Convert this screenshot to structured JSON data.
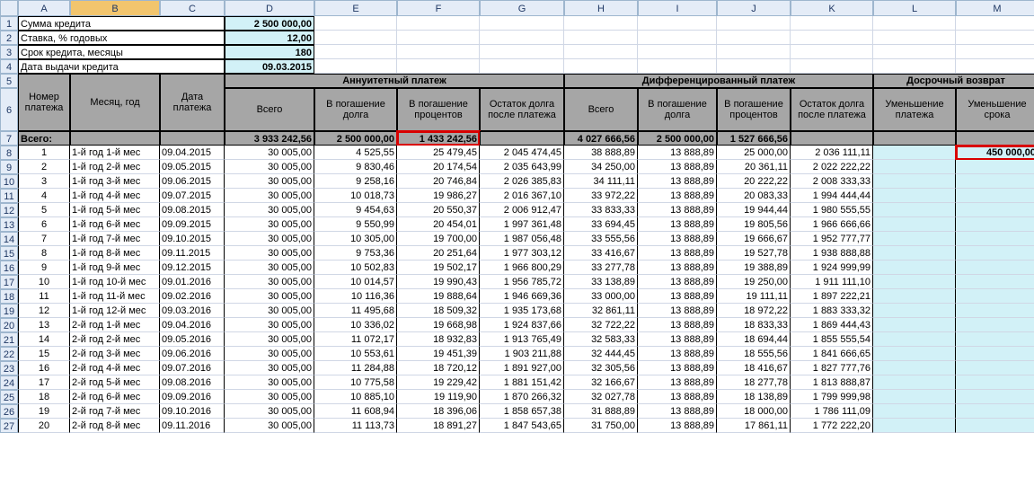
{
  "cols": [
    "",
    "A",
    "B",
    "C",
    "D",
    "E",
    "F",
    "G",
    "H",
    "I",
    "J",
    "K",
    "L",
    "M"
  ],
  "params": {
    "p1": {
      "label": "Сумма кредита",
      "value": "2 500 000,00"
    },
    "p2": {
      "label": "Ставка, % годовых",
      "value": "12,00"
    },
    "p3": {
      "label": "Срок кредита, месяцы",
      "value": "180"
    },
    "p4": {
      "label": "Дата выдачи кредита",
      "value": "09.03.2015"
    }
  },
  "headers": {
    "num": "Номер платежа",
    "month": "Месяц, год",
    "date": "Дата платежа",
    "ann": "Аннуитетный платеж",
    "diff": "Дифференцированный платеж",
    "early": "Досрочный возврат",
    "total": "Всего",
    "toDebt": "В погашение долга",
    "toPct": "В погашение процентов",
    "remain": "Остаток долга после платежа",
    "decPay": "Уменьшение платежа",
    "decTerm": "Уменьшение срока",
    "allRow": "Всего:"
  },
  "totals": {
    "annTotal": "3 933 242,56",
    "annDebt": "2 500 000,00",
    "annPct": "1 433 242,56",
    "diffTotal": "4 027 666,56",
    "diffDebt": "2 500 000,00",
    "diffPct": "1 527 666,56",
    "early": "450 000,00"
  },
  "rows": [
    {
      "n": "1",
      "m": "1-й год 1-й мес",
      "d": "09.04.2015",
      "a1": "30 005,00",
      "a2": "4 525,55",
      "a3": "25 479,45",
      "a4": "2 045 474,45",
      "b1": "38 888,89",
      "b2": "13 888,89",
      "b3": "25 000,00",
      "b4": "2 036 111,11"
    },
    {
      "n": "2",
      "m": "1-й год 2-й мес",
      "d": "09.05.2015",
      "a1": "30 005,00",
      "a2": "9 830,46",
      "a3": "20 174,54",
      "a4": "2 035 643,99",
      "b1": "34 250,00",
      "b2": "13 888,89",
      "b3": "20 361,11",
      "b4": "2 022 222,22"
    },
    {
      "n": "3",
      "m": "1-й год 3-й мес",
      "d": "09.06.2015",
      "a1": "30 005,00",
      "a2": "9 258,16",
      "a3": "20 746,84",
      "a4": "2 026 385,83",
      "b1": "34 111,11",
      "b2": "13 888,89",
      "b3": "20 222,22",
      "b4": "2 008 333,33"
    },
    {
      "n": "4",
      "m": "1-й год 4-й мес",
      "d": "09.07.2015",
      "a1": "30 005,00",
      "a2": "10 018,73",
      "a3": "19 986,27",
      "a4": "2 016 367,10",
      "b1": "33 972,22",
      "b2": "13 888,89",
      "b3": "20 083,33",
      "b4": "1 994 444,44"
    },
    {
      "n": "5",
      "m": "1-й год 5-й мес",
      "d": "09.08.2015",
      "a1": "30 005,00",
      "a2": "9 454,63",
      "a3": "20 550,37",
      "a4": "2 006 912,47",
      "b1": "33 833,33",
      "b2": "13 888,89",
      "b3": "19 944,44",
      "b4": "1 980 555,55"
    },
    {
      "n": "6",
      "m": "1-й год 6-й мес",
      "d": "09.09.2015",
      "a1": "30 005,00",
      "a2": "9 550,99",
      "a3": "20 454,01",
      "a4": "1 997 361,48",
      "b1": "33 694,45",
      "b2": "13 888,89",
      "b3": "19 805,56",
      "b4": "1 966 666,66"
    },
    {
      "n": "7",
      "m": "1-й год 7-й мес",
      "d": "09.10.2015",
      "a1": "30 005,00",
      "a2": "10 305,00",
      "a3": "19 700,00",
      "a4": "1 987 056,48",
      "b1": "33 555,56",
      "b2": "13 888,89",
      "b3": "19 666,67",
      "b4": "1 952 777,77"
    },
    {
      "n": "8",
      "m": "1-й год 8-й мес",
      "d": "09.11.2015",
      "a1": "30 005,00",
      "a2": "9 753,36",
      "a3": "20 251,64",
      "a4": "1 977 303,12",
      "b1": "33 416,67",
      "b2": "13 888,89",
      "b3": "19 527,78",
      "b4": "1 938 888,88"
    },
    {
      "n": "9",
      "m": "1-й год 9-й мес",
      "d": "09.12.2015",
      "a1": "30 005,00",
      "a2": "10 502,83",
      "a3": "19 502,17",
      "a4": "1 966 800,29",
      "b1": "33 277,78",
      "b2": "13 888,89",
      "b3": "19 388,89",
      "b4": "1 924 999,99"
    },
    {
      "n": "10",
      "m": "1-й год 10-й мес",
      "d": "09.01.2016",
      "a1": "30 005,00",
      "a2": "10 014,57",
      "a3": "19 990,43",
      "a4": "1 956 785,72",
      "b1": "33 138,89",
      "b2": "13 888,89",
      "b3": "19 250,00",
      "b4": "1 911 111,10"
    },
    {
      "n": "11",
      "m": "1-й год 11-й мес",
      "d": "09.02.2016",
      "a1": "30 005,00",
      "a2": "10 116,36",
      "a3": "19 888,64",
      "a4": "1 946 669,36",
      "b1": "33 000,00",
      "b2": "13 888,89",
      "b3": "19 111,11",
      "b4": "1 897 222,21"
    },
    {
      "n": "12",
      "m": "1-й год 12-й мес",
      "d": "09.03.2016",
      "a1": "30 005,00",
      "a2": "11 495,68",
      "a3": "18 509,32",
      "a4": "1 935 173,68",
      "b1": "32 861,11",
      "b2": "13 888,89",
      "b3": "18 972,22",
      "b4": "1 883 333,32"
    },
    {
      "n": "13",
      "m": "2-й год 1-й мес",
      "d": "09.04.2016",
      "a1": "30 005,00",
      "a2": "10 336,02",
      "a3": "19 668,98",
      "a4": "1 924 837,66",
      "b1": "32 722,22",
      "b2": "13 888,89",
      "b3": "18 833,33",
      "b4": "1 869 444,43"
    },
    {
      "n": "14",
      "m": "2-й год 2-й мес",
      "d": "09.05.2016",
      "a1": "30 005,00",
      "a2": "11 072,17",
      "a3": "18 932,83",
      "a4": "1 913 765,49",
      "b1": "32 583,33",
      "b2": "13 888,89",
      "b3": "18 694,44",
      "b4": "1 855 555,54"
    },
    {
      "n": "15",
      "m": "2-й год 3-й мес",
      "d": "09.06.2016",
      "a1": "30 005,00",
      "a2": "10 553,61",
      "a3": "19 451,39",
      "a4": "1 903 211,88",
      "b1": "32 444,45",
      "b2": "13 888,89",
      "b3": "18 555,56",
      "b4": "1 841 666,65"
    },
    {
      "n": "16",
      "m": "2-й год 4-й мес",
      "d": "09.07.2016",
      "a1": "30 005,00",
      "a2": "11 284,88",
      "a3": "18 720,12",
      "a4": "1 891 927,00",
      "b1": "32 305,56",
      "b2": "13 888,89",
      "b3": "18 416,67",
      "b4": "1 827 777,76"
    },
    {
      "n": "17",
      "m": "2-й год 5-й мес",
      "d": "09.08.2016",
      "a1": "30 005,00",
      "a2": "10 775,58",
      "a3": "19 229,42",
      "a4": "1 881 151,42",
      "b1": "32 166,67",
      "b2": "13 888,89",
      "b3": "18 277,78",
      "b4": "1 813 888,87"
    },
    {
      "n": "18",
      "m": "2-й год 6-й мес",
      "d": "09.09.2016",
      "a1": "30 005,00",
      "a2": "10 885,10",
      "a3": "19 119,90",
      "a4": "1 870 266,32",
      "b1": "32 027,78",
      "b2": "13 888,89",
      "b3": "18 138,89",
      "b4": "1 799 999,98"
    },
    {
      "n": "19",
      "m": "2-й год 7-й мес",
      "d": "09.10.2016",
      "a1": "30 005,00",
      "a2": "11 608,94",
      "a3": "18 396,06",
      "a4": "1 858 657,38",
      "b1": "31 888,89",
      "b2": "13 888,89",
      "b3": "18 000,00",
      "b4": "1 786 111,09"
    },
    {
      "n": "20",
      "m": "2-й год 8-й мес",
      "d": "09.11.2016",
      "a1": "30 005,00",
      "a2": "11 113,73",
      "a3": "18 891,27",
      "a4": "1 847 543,65",
      "b1": "31 750,00",
      "b2": "13 888,89",
      "b3": "17 861,11",
      "b4": "1 772 222,20"
    }
  ]
}
